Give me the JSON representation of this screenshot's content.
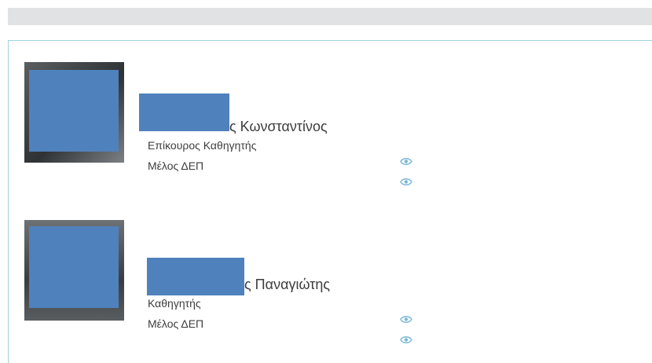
{
  "people": [
    {
      "name_visible": "ς Κωνσταντίνος",
      "title": "Επίκουρος Καθηγητής",
      "role": "Μέλος ΔΕΠ",
      "icons": [
        "eye-icon",
        "eye-icon"
      ]
    },
    {
      "name_visible": "ς Παναγιώτης",
      "title": "Καθηγητής",
      "role": "Μέλος ΔΕΠ",
      "icons": [
        "eye-icon",
        "eye-icon"
      ]
    }
  ],
  "colors": {
    "top_bar": "#e1e2e4",
    "panel_border": "#9fd3e3",
    "redaction": "#4f81bd",
    "eye_icon": "#7ab8d8",
    "text": "#3d3d3d"
  }
}
